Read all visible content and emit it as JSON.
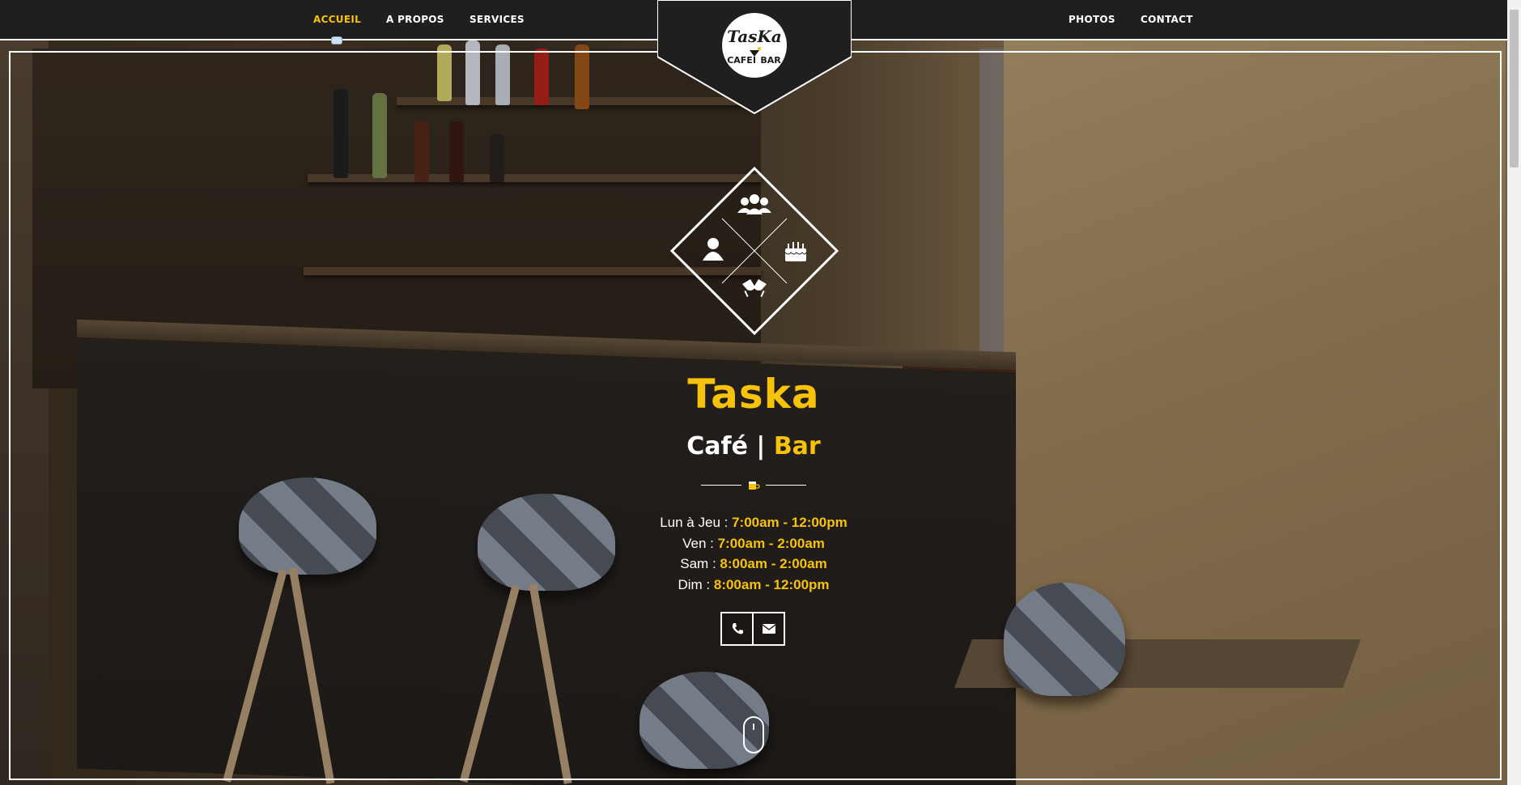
{
  "nav": {
    "left": [
      {
        "label": "ACCUEIL",
        "active": true
      },
      {
        "label": "A PROPOS",
        "active": false
      },
      {
        "label": "SERVICES",
        "active": false
      }
    ],
    "right": [
      {
        "label": "PHOTOS"
      },
      {
        "label": "CONTACT"
      }
    ]
  },
  "logo": {
    "line1": "TasKa",
    "line2": "CAFE",
    "line3": "BAR"
  },
  "services_icons": [
    "group-icon",
    "user-icon",
    "birthday-cake-icon",
    "cheers-glasses-icon"
  ],
  "brand": {
    "title": "Taska",
    "sub_cafe": "Café",
    "sub_separator": "|",
    "sub_bar": "Bar",
    "divider_icon": "beer-mug-icon"
  },
  "hours": [
    {
      "day": "Lun à Jeu :",
      "time": "7:00am - 12:00pm"
    },
    {
      "day": "Ven :",
      "time": "7:00am - 2:00am"
    },
    {
      "day": "Sam :",
      "time": "8:00am - 2:00am"
    },
    {
      "day": "Dim :",
      "time": "8:00am - 12:00pm"
    }
  ],
  "contact": {
    "phone_icon": "phone-icon",
    "email_icon": "envelope-icon"
  },
  "colors": {
    "accent": "#f7c20b",
    "navbar": "#1f1f1f",
    "text": "#ffffff"
  }
}
